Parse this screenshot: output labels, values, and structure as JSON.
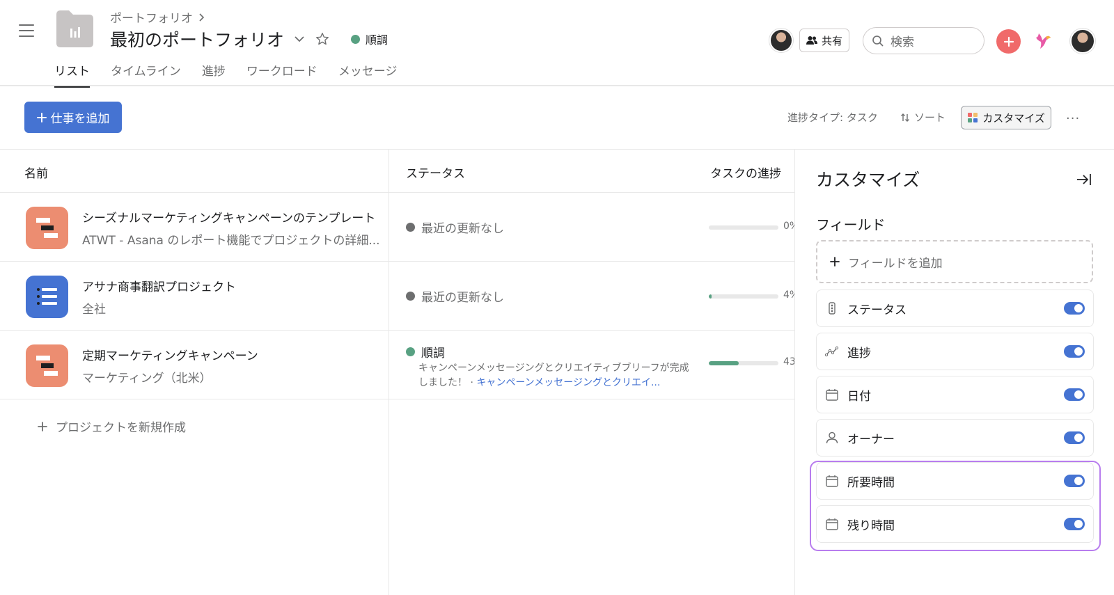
{
  "header": {
    "breadcrumb": "ポートフォリオ",
    "title": "最初のポートフォリオ",
    "status": "順調",
    "status_color": "#58a182",
    "share_label": "共有",
    "search_placeholder": "検索",
    "tabs": [
      {
        "label": "リスト",
        "active": true
      },
      {
        "label": "タイムライン",
        "active": false
      },
      {
        "label": "進捗",
        "active": false
      },
      {
        "label": "ワークロード",
        "active": false
      },
      {
        "label": "メッセージ",
        "active": false
      }
    ]
  },
  "toolbar": {
    "add_work_label": "仕事を追加",
    "progress_type": "進捗タイプ: タスク",
    "sort_label": "ソート",
    "customize_label": "カスタマイズ",
    "more_label": "···"
  },
  "table": {
    "columns": [
      "名前",
      "ステータス",
      "タスクの進捗"
    ],
    "rows": [
      {
        "name": "シーズナルマーケティングキャンペーンのテンプレート",
        "subtitle": "ATWT - Asana のレポート機能でプロジェクトの詳細...",
        "icon": "timeline-icon",
        "icon_color": "#ec8d71",
        "status": "最近の更新なし",
        "status_color": "#6d6e6f",
        "progress": 0,
        "progress_label": "0%"
      },
      {
        "name": "アサナ商事翻訳プロジェクト",
        "subtitle": "全社",
        "icon": "list-icon",
        "icon_color": "#4573d2",
        "status": "最近の更新なし",
        "status_color": "#6d6e6f",
        "progress": 4,
        "progress_label": "4%"
      },
      {
        "name": "定期マーケティングキャンペーン",
        "subtitle": "マーケティング（北米）",
        "icon": "timeline-icon",
        "icon_color": "#ec8d71",
        "status": "順調",
        "status_color": "#58a182",
        "status_message": "キャンペーンメッセージングとクリエイティブブリーフが完成しました！ · ",
        "status_link": "キャンペーンメッセージングとクリエイ...",
        "progress": 43,
        "progress_label": "43"
      }
    ],
    "new_project_label": "プロジェクトを新規作成"
  },
  "panel": {
    "title": "カスタマイズ",
    "fields_label": "フィールド",
    "add_field_label": "フィールドを追加",
    "fields": [
      {
        "label": "ステータス",
        "icon": "traffic-light-icon",
        "enabled": true
      },
      {
        "label": "進捗",
        "icon": "progress-icon",
        "enabled": true
      },
      {
        "label": "日付",
        "icon": "calendar-icon",
        "enabled": true
      },
      {
        "label": "オーナー",
        "icon": "person-icon",
        "enabled": true
      },
      {
        "label": "所要時間",
        "icon": "calendar-icon",
        "enabled": true
      },
      {
        "label": "残り時間",
        "icon": "calendar-icon",
        "enabled": true
      }
    ],
    "highlight_color": "#b87dee"
  }
}
